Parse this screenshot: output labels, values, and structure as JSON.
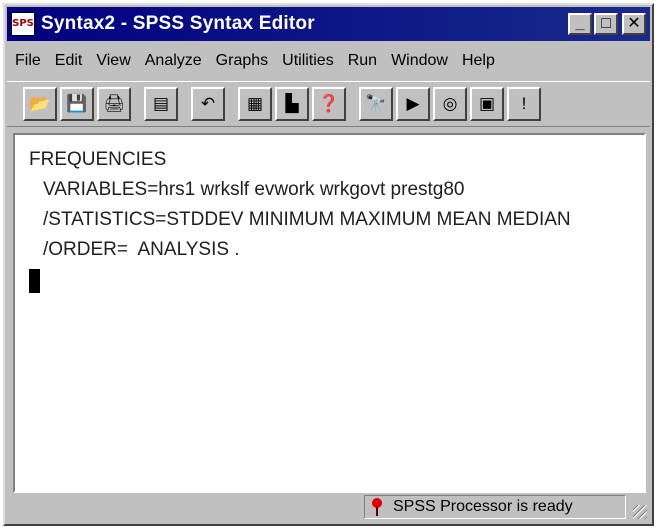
{
  "window": {
    "title": "Syntax2 - SPSS Syntax Editor",
    "icon_label": "SPS",
    "controls": {
      "minimize": "_",
      "maximize": "□",
      "close": "✕"
    }
  },
  "menu": [
    {
      "label": "File"
    },
    {
      "label": "Edit"
    },
    {
      "label": "View"
    },
    {
      "label": "Analyze"
    },
    {
      "label": "Graphs"
    },
    {
      "label": "Utilities"
    },
    {
      "label": "Run"
    },
    {
      "label": "Window"
    },
    {
      "label": "Help"
    }
  ],
  "toolbar": [
    {
      "name": "open-icon",
      "glyph": "📂"
    },
    {
      "name": "save-icon",
      "glyph": "💾"
    },
    {
      "name": "print-icon",
      "glyph": "🖨"
    },
    {
      "name": "dialog-recall-icon",
      "glyph": "▤"
    },
    {
      "name": "undo-icon",
      "glyph": "↶"
    },
    {
      "name": "goto-data-icon",
      "glyph": "▦"
    },
    {
      "name": "goto-chart-icon",
      "glyph": "▙"
    },
    {
      "name": "variables-icon",
      "glyph": "❓"
    },
    {
      "name": "find-icon",
      "glyph": "🔭"
    },
    {
      "name": "run-icon",
      "glyph": "▶"
    },
    {
      "name": "use-sets-icon",
      "glyph": "◎"
    },
    {
      "name": "syntax-help-icon",
      "glyph": "▣"
    },
    {
      "name": "designate-window-icon",
      "glyph": "!"
    }
  ],
  "editor": {
    "lines": [
      "FREQUENCIES",
      "VARIABLES=hrs1 wrkslf evwork wrkgovt prestg80",
      "/STATISTICS=STDDEV MINIMUM MAXIMUM MEAN MEDIAN",
      "/ORDER=  ANALYSIS ."
    ]
  },
  "status": {
    "text": "SPSS Processor  is ready",
    "indicator_color": "#e00000"
  }
}
